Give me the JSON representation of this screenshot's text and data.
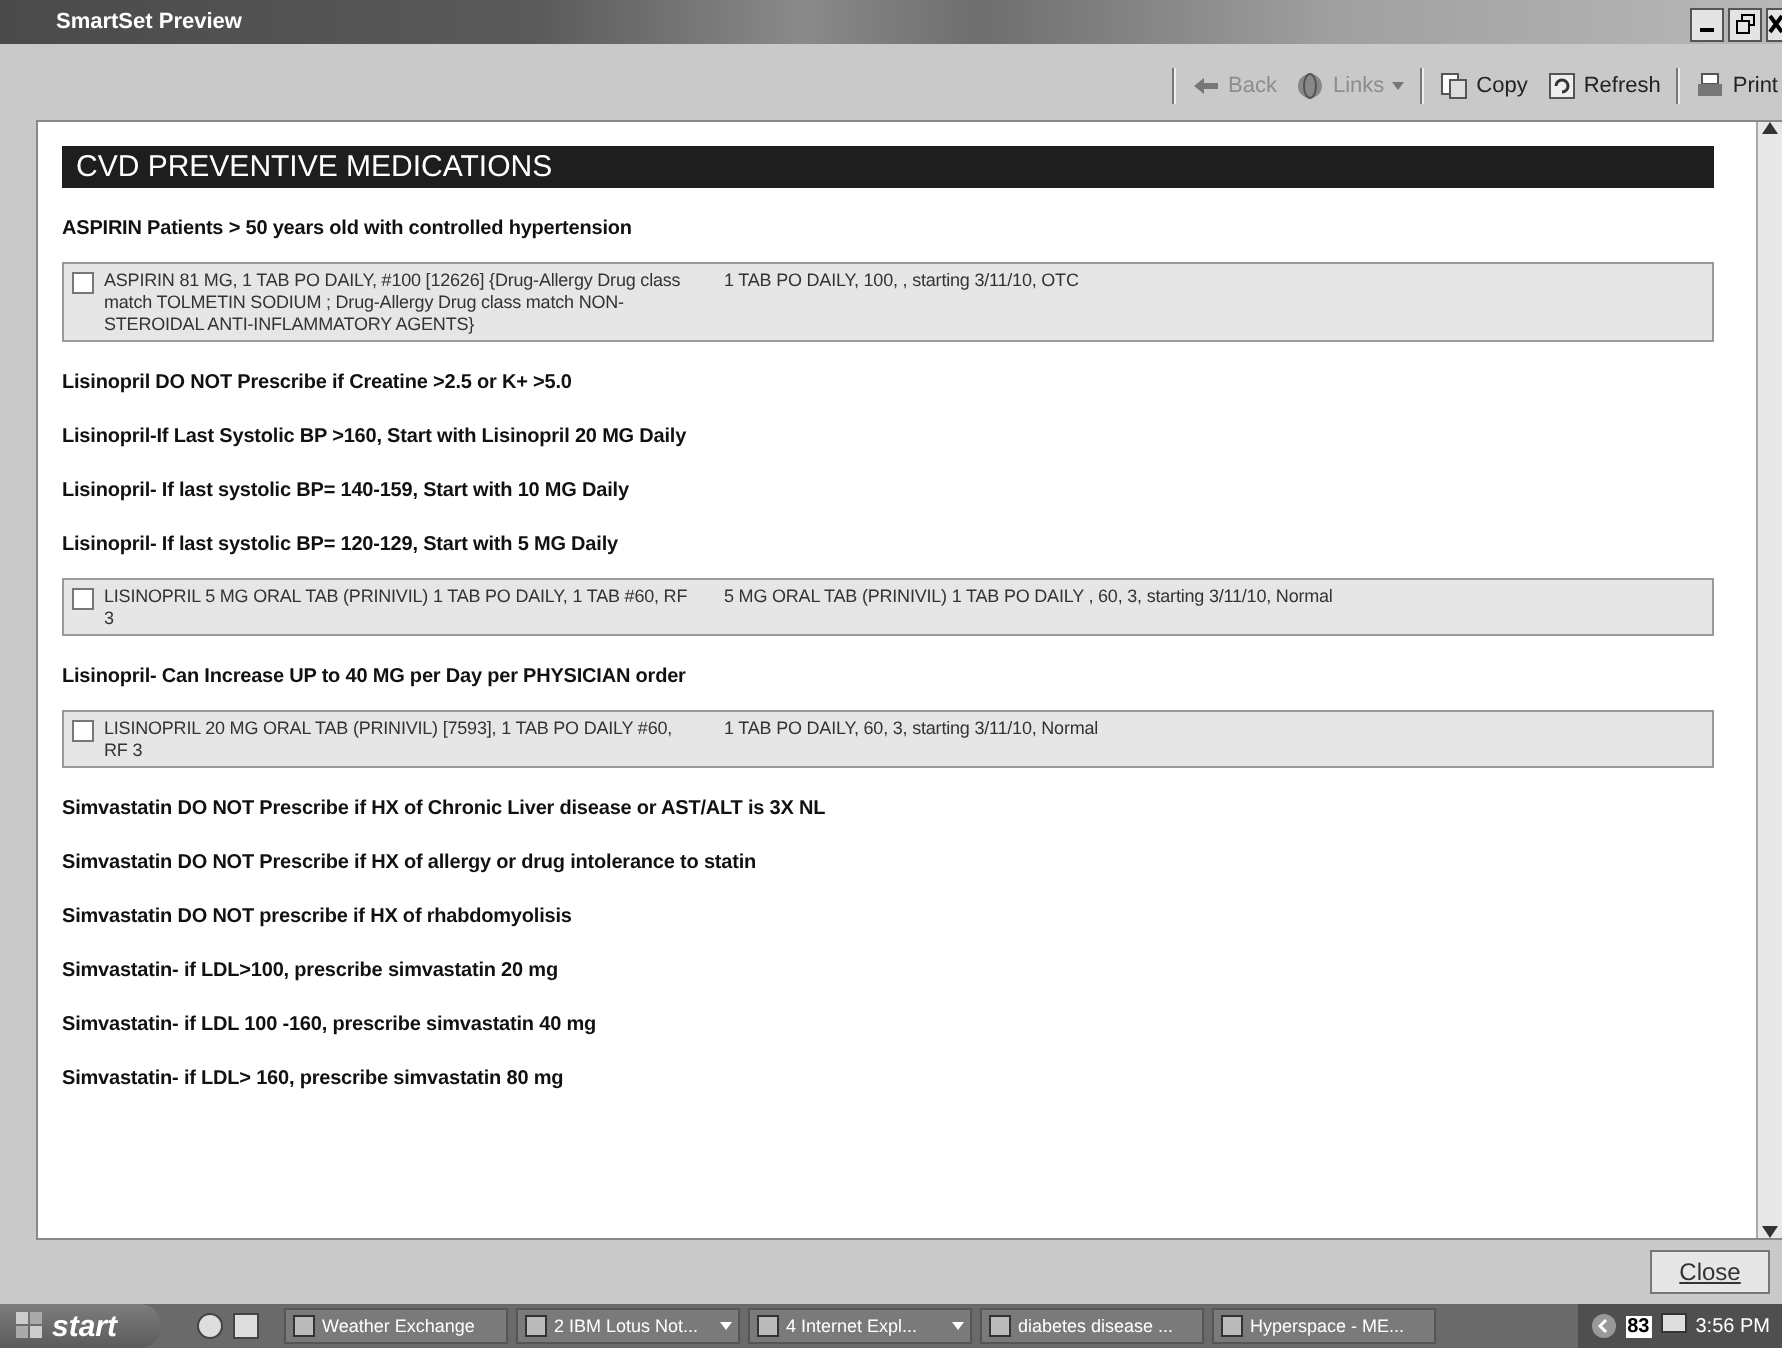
{
  "window": {
    "title": "SmartSet Preview"
  },
  "toolbar": [
    {
      "kind": "back",
      "label": "Back",
      "disabled": true
    },
    {
      "kind": "links",
      "label": "Links",
      "disabled": true
    },
    {
      "kind": "copy",
      "label": "Copy",
      "disabled": false
    },
    {
      "kind": "refresh",
      "label": "Refresh",
      "disabled": false
    },
    {
      "kind": "print",
      "label": "Print",
      "disabled": false
    }
  ],
  "section": {
    "title": "CVD PREVENTIVE MEDICATIONS"
  },
  "items": [
    {
      "kind": "note",
      "text": "ASPIRIN Patients > 50 years old with controlled hypertension"
    },
    {
      "kind": "order",
      "checked": false,
      "order": "ASPIRIN  81 MG, 1 TAB PO DAILY, #100 [12626]   {Drug-Allergy Drug class match TOLMETIN SODIUM ; Drug-Allergy Drug class match NON-STEROIDAL ANTI-INFLAMMATORY AGENTS}",
      "details": "1 TAB PO DAILY, 100, , starting 3/11/10, OTC"
    },
    {
      "kind": "note",
      "text": "Lisinopril DO NOT Prescribe if Creatine >2.5 or K+ >5.0"
    },
    {
      "kind": "note",
      "text": "Lisinopril-If Last Systolic BP >160, Start with Lisinopril 20 MG Daily"
    },
    {
      "kind": "note",
      "text": "Lisinopril- If last systolic BP= 140-159, Start with 10 MG Daily"
    },
    {
      "kind": "note",
      "text": "Lisinopril- If last systolic BP= 120-129, Start with 5 MG Daily"
    },
    {
      "kind": "order",
      "checked": false,
      "order": "LISINOPRIL  5 MG ORAL TAB (PRINIVIL) 1 TAB PO DAILY, 1 TAB #60, RF 3",
      "details": "5 MG ORAL TAB (PRINIVIL) 1 TAB PO DAILY , 60, 3, starting 3/11/10, Normal"
    },
    {
      "kind": "note",
      "text": "Lisinopril- Can Increase UP to 40 MG per Day per PHYSICIAN order"
    },
    {
      "kind": "order",
      "checked": false,
      "order": "LISINOPRIL 20 MG ORAL TAB (PRINIVIL)  [7593], 1 TAB PO DAILY #60, RF 3",
      "details": "1 TAB PO DAILY, 60, 3, starting 3/11/10, Normal"
    },
    {
      "kind": "note",
      "text": "Simvastatin DO NOT Prescribe if HX of Chronic Liver disease or AST/ALT is 3X NL"
    },
    {
      "kind": "note",
      "text": "Simvastatin DO NOT Prescribe if HX of allergy or drug intolerance to statin"
    },
    {
      "kind": "note",
      "text": "Simvastatin DO NOT prescribe if HX of rhabdomyolisis"
    },
    {
      "kind": "note",
      "text": "Simvastatin- if LDL>100, prescribe simvastatin 20 mg"
    },
    {
      "kind": "note",
      "text": "Simvastatin- if LDL 100 -160, prescribe simvastatin 40 mg"
    },
    {
      "kind": "note",
      "text": "Simvastatin- if LDL> 160, prescribe simvastatin 80 mg"
    }
  ],
  "close_button": {
    "label": "Close"
  },
  "taskbar": {
    "start": "start",
    "tasks": [
      {
        "label": "Weather Exchange",
        "grouped": false
      },
      {
        "label": "2 IBM Lotus Not...",
        "grouped": true
      },
      {
        "label": "4 Internet Expl...",
        "grouped": true
      },
      {
        "label": "diabetes disease ...",
        "grouped": false
      },
      {
        "label": "Hyperspace - ME...",
        "grouped": false
      }
    ],
    "tray_badge": "83",
    "clock": "3:56 PM"
  }
}
